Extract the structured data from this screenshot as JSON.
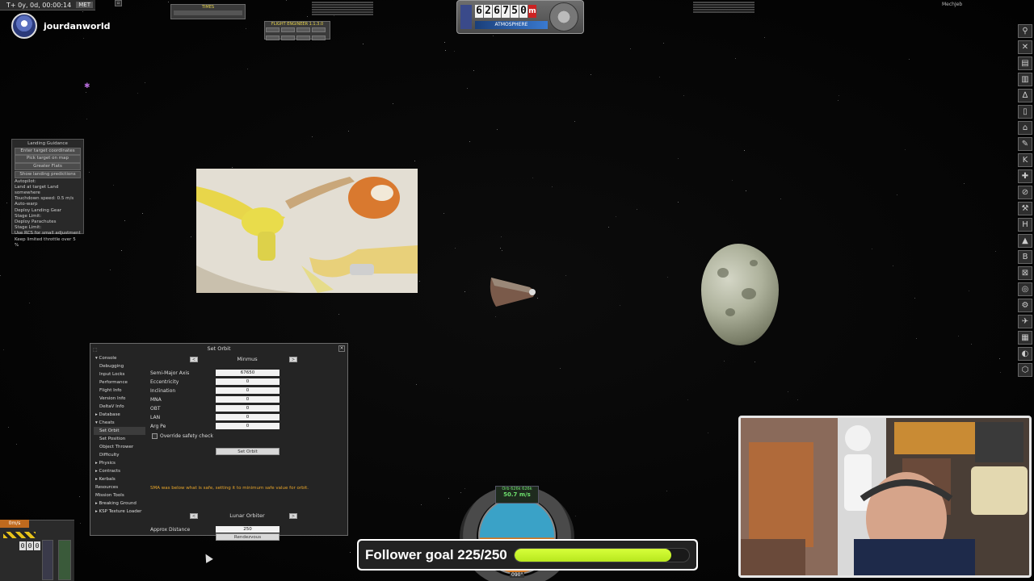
{
  "hud": {
    "met_time": "T+ 0y, 0d, 00:00:14",
    "met_label": "MET",
    "streamer_name": "jourdanworld",
    "mechjeb_label": "MechJeb",
    "fe_title": "FLIGHT ENGINEER 1.1.3.0",
    "timer_title": "TIMES",
    "altitude_digits": [
      "6",
      "2",
      "6",
      "7",
      "5",
      "0"
    ],
    "altitude_unit": "m",
    "atmosphere_label": "ATMOSPHERE"
  },
  "landing_guidance": {
    "title": "Landing Guidance",
    "items": [
      "Enter target coordinates",
      "Pick target on map",
      "Greater Flats",
      "Show landing predictions",
      "Autopilot:",
      "Land at target   Land somewhere",
      "Touchdown speed:  0.5 m/s",
      "Auto-warp",
      "Deploy Landing Gear",
      "Stage Limit:",
      "Deploy Parachutes",
      "Stage Limit:",
      "Use RCS for small adjustment",
      "Keep limited throttle over 5 %"
    ]
  },
  "set_orbit": {
    "title": "Set Orbit",
    "tree": [
      {
        "label": "Console",
        "type": "cat"
      },
      {
        "label": "Debugging",
        "type": "item"
      },
      {
        "label": "Input Locks",
        "type": "item"
      },
      {
        "label": "Performance",
        "type": "item"
      },
      {
        "label": "Flight Info",
        "type": "item"
      },
      {
        "label": "Version Info",
        "type": "item"
      },
      {
        "label": "DeltaV Info",
        "type": "item"
      },
      {
        "label": "Database",
        "type": "cat"
      },
      {
        "label": "Cheats",
        "type": "cat"
      },
      {
        "label": "Set Orbit",
        "type": "sel"
      },
      {
        "label": "Set Position",
        "type": "item"
      },
      {
        "label": "Object Thrower",
        "type": "item"
      },
      {
        "label": "Difficulty",
        "type": "item"
      },
      {
        "label": "Physics",
        "type": "cat"
      },
      {
        "label": "Contracts",
        "type": "cat"
      },
      {
        "label": "Kerbals",
        "type": "cat"
      },
      {
        "label": "Resources",
        "type": "plain"
      },
      {
        "label": "Mission Tools",
        "type": "plain"
      },
      {
        "label": "Breaking Ground",
        "type": "cat"
      },
      {
        "label": "KSP Texture Loader",
        "type": "cat"
      }
    ],
    "body": "Minmus",
    "fields": [
      {
        "label": "Semi-Major Axis",
        "value": "67650"
      },
      {
        "label": "Eccentricity",
        "value": "0"
      },
      {
        "label": "Inclination",
        "value": "0"
      },
      {
        "label": "MNA",
        "value": "0"
      },
      {
        "label": "OBT",
        "value": "0"
      },
      {
        "label": "LAN",
        "value": "0"
      },
      {
        "label": "Arg Pe",
        "value": "0"
      }
    ],
    "override_label": "Override safety check",
    "set_orbit_button": "Set Orbit",
    "warning": "SMA was below what is safe, setting it to minimum safe value for orbit.",
    "lunar_orbiter": "Lunar Orbiter",
    "approx_distance_label": "Approx Distance",
    "approx_distance_value": "250",
    "rendezvous_button": "Rendezvous"
  },
  "navball": {
    "orbit_line": "Orb 626k 626k",
    "speed": "50.7 m/s",
    "heading": "090°"
  },
  "follower_goal": {
    "text": "Follower goal 225/250",
    "current": 225,
    "target": 250,
    "bar_color": "#c6f42a"
  },
  "bottom_left": {
    "speed_badge": "0m/s",
    "counter": [
      "0",
      "0",
      "0"
    ]
  }
}
